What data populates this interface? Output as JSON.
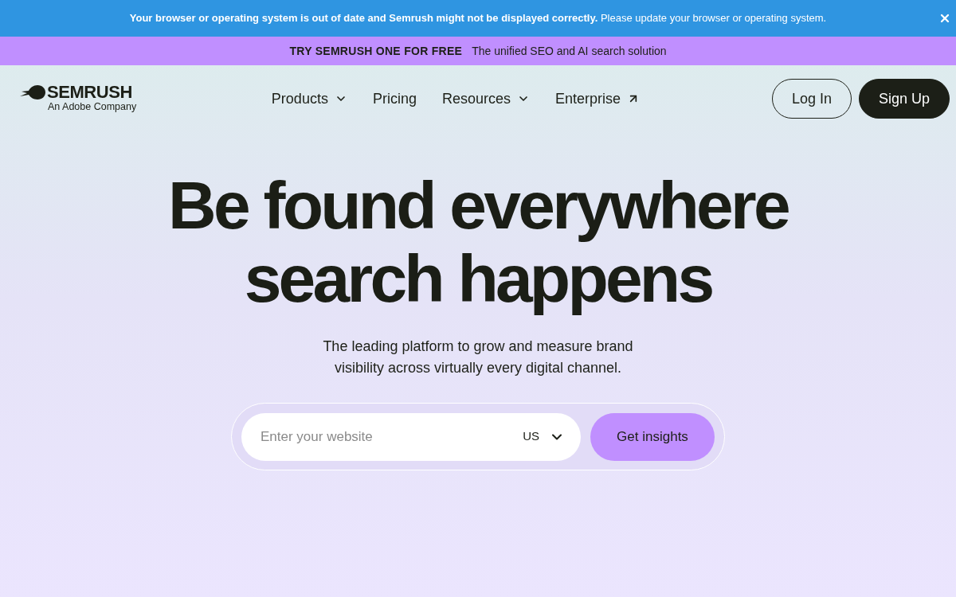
{
  "alert_banner": {
    "message_bold": "Your browser or operating system is out of date and Semrush might not be displayed correctly.",
    "message": "Please update your browser or operating system."
  },
  "promo_banner": {
    "label": "TRY SEMRUSH ONE FOR FREE",
    "text": "The unified SEO and AI search solution"
  },
  "header": {
    "logo": {
      "name": "SEMRUSH",
      "tagline": "An Adobe Company"
    },
    "nav": [
      {
        "label": "Products",
        "kind": "dropdown"
      },
      {
        "label": "Pricing",
        "kind": "link"
      },
      {
        "label": "Resources",
        "kind": "dropdown"
      },
      {
        "label": "Enterprise",
        "kind": "external"
      }
    ],
    "buttons": [
      {
        "label": "Log In",
        "kind": "outline"
      },
      {
        "label": "Sign Up",
        "kind": "filled"
      }
    ]
  },
  "hero": {
    "title_lines": [
      "Be found everywhere",
      "search happens"
    ],
    "subtitle": "The leading platform to grow and measure brand visibility across virtually every digital channel.",
    "search": {
      "placeholder": "Enter your website",
      "country": "US",
      "button": "Get insights"
    }
  }
}
